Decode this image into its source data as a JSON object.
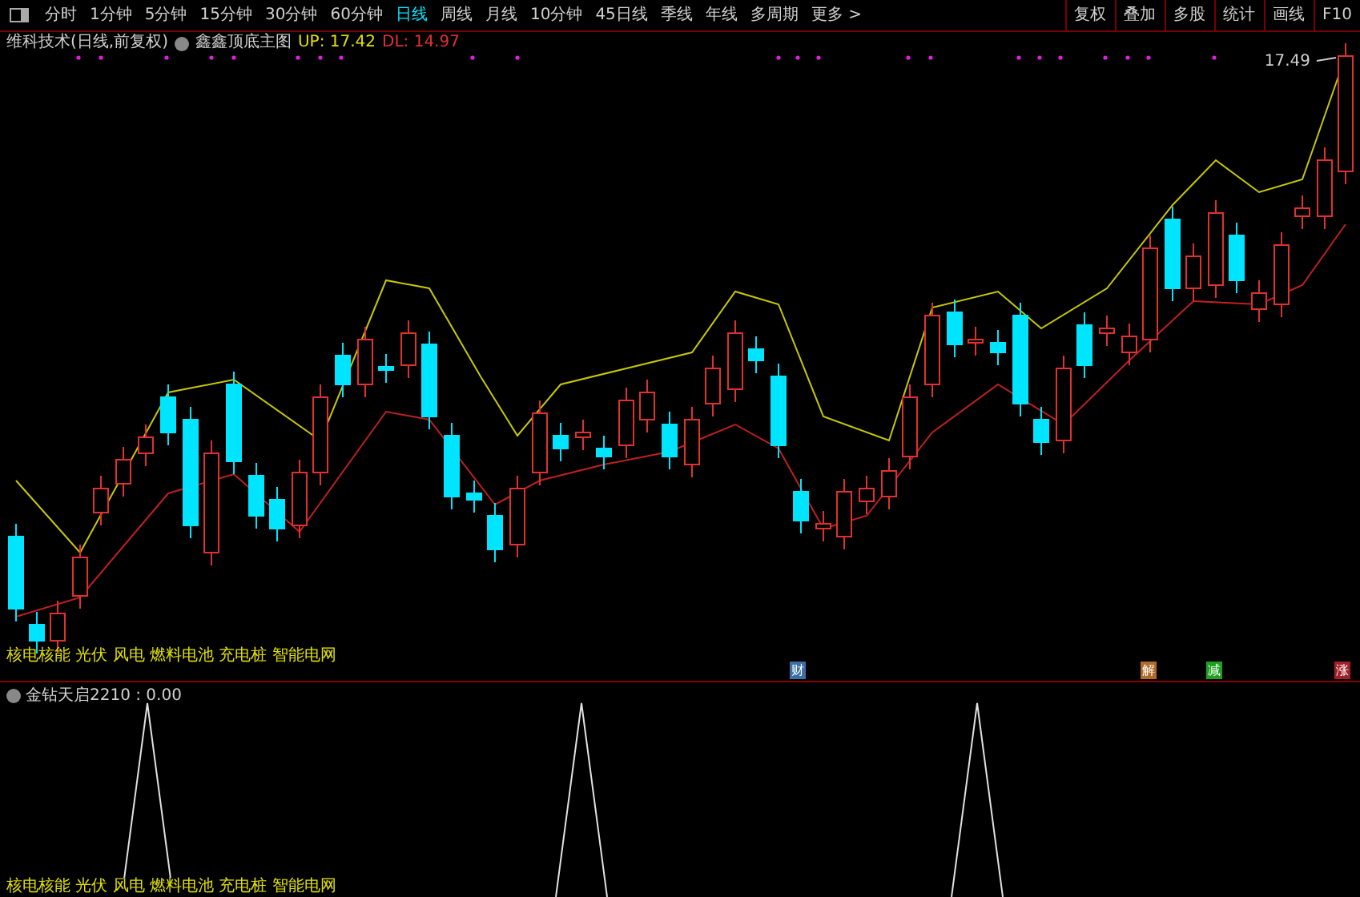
{
  "toolbar": {
    "periods": [
      {
        "label": "分时",
        "selected": false
      },
      {
        "label": "1分钟",
        "selected": false
      },
      {
        "label": "5分钟",
        "selected": false
      },
      {
        "label": "15分钟",
        "selected": false
      },
      {
        "label": "30分钟",
        "selected": false
      },
      {
        "label": "60分钟",
        "selected": false
      },
      {
        "label": "日线",
        "selected": true
      },
      {
        "label": "周线",
        "selected": false
      },
      {
        "label": "月线",
        "selected": false
      },
      {
        "label": "10分钟",
        "selected": false
      },
      {
        "label": "45日线",
        "selected": false
      },
      {
        "label": "季线",
        "selected": false
      },
      {
        "label": "年线",
        "selected": false
      },
      {
        "label": "多周期",
        "selected": false
      },
      {
        "label": "更多 >",
        "selected": false
      }
    ],
    "buttons": [
      "复权",
      "叠加",
      "多股",
      "统计",
      "画线",
      "F10"
    ]
  },
  "main_chart": {
    "title": "维科技术(日线,前复权)",
    "indicator": "鑫鑫顶底主图",
    "up": "UP: 17.42",
    "dl": "DL: 14.97",
    "high_label": "17.49",
    "sector_tags": "核电核能 光伏 风电 燃料电池 充电桩 智能电网",
    "event_badges": [
      {
        "label": "财",
        "color": "#3b6ea5"
      },
      {
        "label": "解",
        "color": "#b06a2a"
      },
      {
        "label": "减",
        "color": "#20a020"
      },
      {
        "label": "涨",
        "color": "#a0202a"
      }
    ]
  },
  "sub_chart": {
    "indicator": "金钻天启2210 : 0.00",
    "sector_tags": "核电核能 光伏 风电 燃料电池 充电桩 智能电网"
  }
}
